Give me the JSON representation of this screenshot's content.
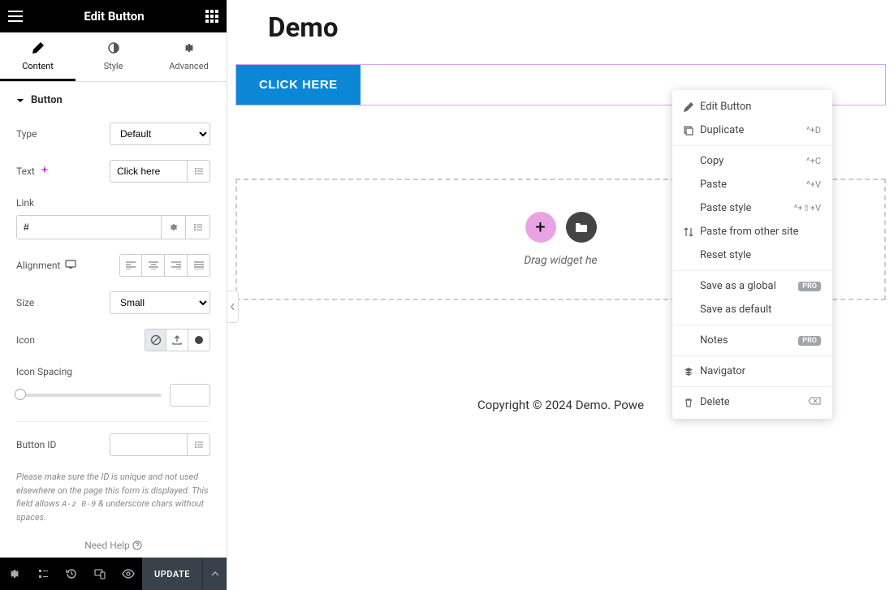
{
  "sidebar": {
    "title": "Edit Button",
    "tabs": {
      "content": "Content",
      "style": "Style",
      "advanced": "Advanced"
    },
    "section": "Button",
    "controls": {
      "type_label": "Type",
      "type_value": "Default",
      "text_label": "Text",
      "text_value": "Click here",
      "link_label": "Link",
      "link_value": "#",
      "alignment_label": "Alignment",
      "size_label": "Size",
      "size_value": "Small",
      "icon_label": "Icon",
      "icon_spacing_label": "Icon Spacing",
      "button_id_label": "Button ID",
      "button_id_value": "",
      "button_id_hint_1": "Please make sure the ID is unique and not used elsewhere on the page this form is displayed. This field allows ",
      "button_id_hint_code": "A-z 0-9",
      "button_id_hint_2": " & underscore chars without spaces."
    },
    "help": "Need Help",
    "update": "UPDATE"
  },
  "preview": {
    "page_title": "Demo",
    "button_text": "CLICK HERE",
    "drop_hint": "Drag widget he",
    "footer": "Copyright © 2024 Demo. Powe"
  },
  "context_menu": {
    "edit": "Edit Button",
    "duplicate": "Duplicate",
    "duplicate_sc": "^+D",
    "copy": "Copy",
    "copy_sc": "^+C",
    "paste": "Paste",
    "paste_sc": "^+V",
    "paste_style": "Paste style",
    "paste_style_sc": "^+⇧+V",
    "paste_other": "Paste from other site",
    "reset_style": "Reset style",
    "save_global": "Save as a global",
    "save_default": "Save as default",
    "notes": "Notes",
    "navigator": "Navigator",
    "delete": "Delete",
    "pro": "PRO"
  }
}
